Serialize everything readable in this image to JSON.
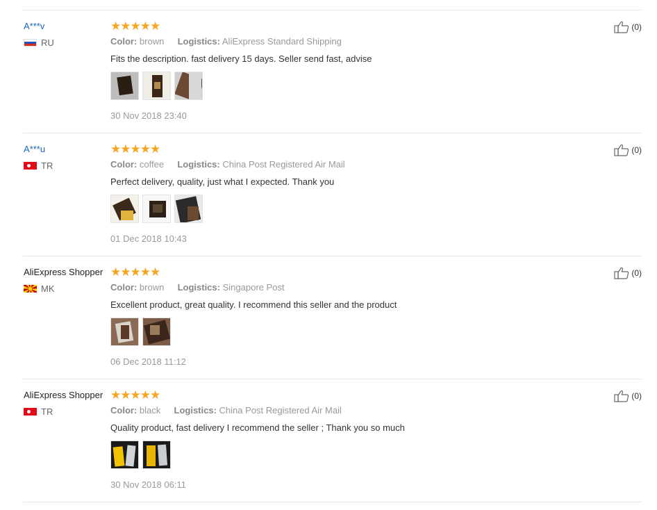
{
  "reviews": [
    {
      "user": "A***v",
      "country": "RU",
      "flag_icon": "flag-ru-icon",
      "rating_stars": "★★★★★",
      "rating": 5,
      "color_label": "Color:",
      "color_value": "brown",
      "logistics_label": "Logistics:",
      "logistics_value": "AliExpress Standard Shipping",
      "comment": "Fits the description. fast delivery 15 days. Seller send fast, advise",
      "photos": [
        "photo-1",
        "photo-2",
        "photo-3"
      ],
      "date": "30 Nov 2018 23:40",
      "helpful": "(0)"
    },
    {
      "user": "A***u",
      "country": "TR",
      "flag_icon": "flag-tr-icon",
      "rating_stars": "★★★★★",
      "rating": 5,
      "color_label": "Color:",
      "color_value": "coffee",
      "logistics_label": "Logistics:",
      "logistics_value": "China Post Registered Air Mail",
      "comment": "Perfect delivery, quality, just what I expected. Thank you",
      "photos": [
        "photo-1",
        "photo-2",
        "photo-3"
      ],
      "date": "01 Dec 2018 10:43",
      "helpful": "(0)"
    },
    {
      "user": "AliExpress Shopper",
      "country": "MK",
      "flag_icon": "flag-mk-icon",
      "rating_stars": "★★★★★",
      "rating": 5,
      "color_label": "Color:",
      "color_value": "brown",
      "logistics_label": "Logistics:",
      "logistics_value": "Singapore Post",
      "comment": "Excellent product, great quality. I recommend this seller and the product",
      "photos": [
        "photo-1",
        "photo-2"
      ],
      "date": "06 Dec 2018 11:12",
      "helpful": "(0)"
    },
    {
      "user": "AliExpress Shopper",
      "country": "TR",
      "flag_icon": "flag-tr-icon",
      "rating_stars": "★★★★★",
      "rating": 5,
      "color_label": "Color:",
      "color_value": "black",
      "logistics_label": "Logistics:",
      "logistics_value": "China Post Registered Air Mail",
      "comment": "Quality product, fast delivery I recommend the seller ; Thank you so much",
      "photos": [
        "photo-1",
        "photo-2"
      ],
      "date": "30 Nov 2018 06:11",
      "helpful": "(0)"
    }
  ],
  "colors": {
    "star": "#f5a623",
    "anon_user": "#1a66b8",
    "muted": "#999999",
    "divider": "#e6e6e6"
  }
}
